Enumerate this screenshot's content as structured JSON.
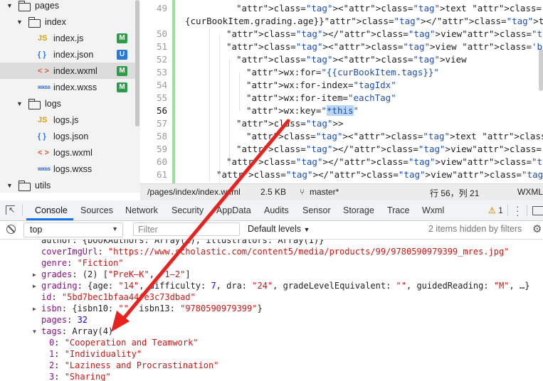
{
  "file_tree": {
    "items": [
      {
        "type": "folder",
        "label": "pages",
        "expanded": true,
        "depth": 0
      },
      {
        "type": "folder",
        "label": "index",
        "expanded": true,
        "depth": 1
      },
      {
        "type": "file",
        "icon": "js",
        "label": "index.js",
        "badge": "M",
        "depth": 2
      },
      {
        "type": "file",
        "icon": "json",
        "label": "index.json",
        "badge": "U",
        "depth": 2
      },
      {
        "type": "file",
        "icon": "wxml",
        "label": "index.wxml",
        "badge": "M",
        "depth": 2,
        "selected": true
      },
      {
        "type": "file",
        "icon": "wxss",
        "label": "index.wxss",
        "badge": "M",
        "depth": 2
      },
      {
        "type": "folder",
        "label": "logs",
        "expanded": true,
        "depth": 1
      },
      {
        "type": "file",
        "icon": "js",
        "label": "logs.js",
        "depth": 2
      },
      {
        "type": "file",
        "icon": "json",
        "label": "logs.json",
        "depth": 2
      },
      {
        "type": "file",
        "icon": "wxml",
        "label": "logs.wxml",
        "depth": 2
      },
      {
        "type": "file",
        "icon": "wxss",
        "label": "logs.wxss",
        "depth": 2
      },
      {
        "type": "folder",
        "label": "utils",
        "expanded": true,
        "depth": 0
      }
    ],
    "icon_glyphs": {
      "js": "JS",
      "json": "{ }",
      "wxml": "< >",
      "wxss": "wxss"
    }
  },
  "editor": {
    "lines": [
      {
        "num": "49",
        "text": "<text class='book_list_attribute_value'>{"
      },
      {
        "num": "",
        "text": "{curBookItem.grading.age}}</text>"
      },
      {
        "num": "50",
        "text": "</view>"
      },
      {
        "num": "51",
        "text": "<view class='book_list_attribute_tags'>"
      },
      {
        "num": "52",
        "text": "<view"
      },
      {
        "num": "53",
        "text": "wx:for=\"{{curBookItem.tags}}\""
      },
      {
        "num": "54",
        "text": "wx:for-index=\"tagIdx\""
      },
      {
        "num": "55",
        "text": "wx:for-item=\"eachTag\""
      },
      {
        "num": "56",
        "text": "wx:key=\"*this\""
      },
      {
        "num": "57",
        "text": ">"
      },
      {
        "num": "58",
        "text": "<text class='book_single_tag'>{{eachTag}}</text>"
      },
      {
        "num": "59",
        "text": "</view>"
      },
      {
        "num": "60",
        "text": "</view>"
      },
      {
        "num": "61",
        "text": "</view>"
      }
    ]
  },
  "status_bar": {
    "path": "/pages/index/index.wxml",
    "size": "2.5 KB",
    "branch": "master*",
    "position": "行 56，列 21",
    "language": "WXML"
  },
  "devtools": {
    "tabs": [
      "Console",
      "Sources",
      "Network",
      "Security",
      "AppData",
      "Audits",
      "Sensor",
      "Storage",
      "Trace",
      "Wxml"
    ],
    "active_tab": "Console",
    "warning_count": "1"
  },
  "console_toolbar": {
    "context": "top",
    "filter_placeholder": "Filter",
    "levels": "Default levels",
    "hidden_info": "2 items hidden by filters"
  },
  "console_output": {
    "lines": [
      {
        "indent": 1,
        "arrow": "",
        "parts": [
          [
            "cplain",
            "author: {bookAuthors: Array(1), illustrators: Array(1)}"
          ]
        ]
      },
      {
        "indent": 1,
        "arrow": "",
        "parts": [
          [
            "key",
            "coverImgUrl"
          ],
          [
            "cplain",
            ": "
          ],
          [
            "cstr",
            "\"https://www.scholastic.com/content5/media/products/99/9780590979399_mres.jpg\""
          ]
        ]
      },
      {
        "indent": 1,
        "arrow": "",
        "parts": [
          [
            "key",
            "genre"
          ],
          [
            "cplain",
            ": "
          ],
          [
            "cstr",
            "\"Fiction\""
          ]
        ]
      },
      {
        "indent": 1,
        "arrow": "right",
        "parts": [
          [
            "key",
            "grades"
          ],
          [
            "cplain",
            ": (2) ["
          ],
          [
            "cstr",
            "\"PreK–K\""
          ],
          [
            "cplain",
            ", "
          ],
          [
            "cstr",
            "\"1–2\""
          ],
          [
            "cplain",
            "]"
          ]
        ]
      },
      {
        "indent": 1,
        "arrow": "right",
        "parts": [
          [
            "key",
            "grading"
          ],
          [
            "cplain",
            ": {age: "
          ],
          [
            "cstr",
            "\"14\""
          ],
          [
            "cplain",
            ", difficulty: "
          ],
          [
            "cnum",
            "7"
          ],
          [
            "cplain",
            ", dra: "
          ],
          [
            "cstr",
            "\"24\""
          ],
          [
            "cplain",
            ", gradeLevelEquivalent: "
          ],
          [
            "cstr",
            "\"\""
          ],
          [
            "cplain",
            ", guidedReading: "
          ],
          [
            "cstr",
            "\"M\""
          ],
          [
            "cplain",
            ", …}"
          ]
        ]
      },
      {
        "indent": 1,
        "arrow": "",
        "parts": [
          [
            "key",
            "id"
          ],
          [
            "cplain",
            ": "
          ],
          [
            "cstr",
            "\"5bd7bec1bfaa44fe3c73dbad\""
          ]
        ]
      },
      {
        "indent": 1,
        "arrow": "right",
        "parts": [
          [
            "key",
            "isbn"
          ],
          [
            "cplain",
            ": {isbn10: "
          ],
          [
            "cstr",
            "\"\""
          ],
          [
            "cplain",
            ", isbn13: "
          ],
          [
            "cstr",
            "\"9780590979399\""
          ],
          [
            "cplain",
            "}"
          ]
        ]
      },
      {
        "indent": 1,
        "arrow": "",
        "parts": [
          [
            "key",
            "pages"
          ],
          [
            "cplain",
            ": "
          ],
          [
            "cnum",
            "32"
          ]
        ]
      },
      {
        "indent": 1,
        "arrow": "down",
        "parts": [
          [
            "key",
            "tags"
          ],
          [
            "cplain",
            ": Array(4)"
          ]
        ]
      },
      {
        "indent": 2,
        "arrow": "",
        "parts": [
          [
            "key",
            "0"
          ],
          [
            "cplain",
            ": "
          ],
          [
            "cstr",
            "\"Cooperation and Teamwork\""
          ]
        ]
      },
      {
        "indent": 2,
        "arrow": "",
        "parts": [
          [
            "key",
            "1"
          ],
          [
            "cplain",
            ": "
          ],
          [
            "cstr",
            "\"Individuality\""
          ]
        ]
      },
      {
        "indent": 2,
        "arrow": "",
        "parts": [
          [
            "key",
            "2"
          ],
          [
            "cplain",
            ": "
          ],
          [
            "cstr",
            "\"Laziness and Procrastination\""
          ]
        ]
      },
      {
        "indent": 2,
        "arrow": "",
        "parts": [
          [
            "key",
            "3"
          ],
          [
            "cplain",
            ": "
          ],
          [
            "cstr",
            "\"Sharing\""
          ]
        ]
      }
    ]
  },
  "annotation": {
    "color": "#e8231f"
  }
}
